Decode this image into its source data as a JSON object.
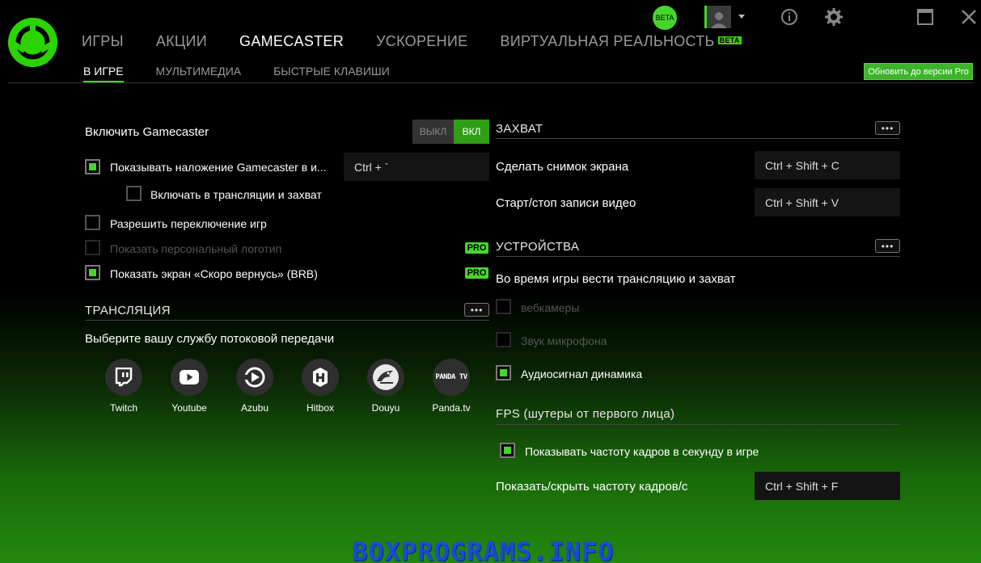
{
  "header": {
    "tabs": [
      {
        "label": "ИГРЫ"
      },
      {
        "label": "АКЦИИ"
      },
      {
        "label": "GAMECASTER",
        "active": true
      },
      {
        "label": "УСКОРЕНИЕ"
      },
      {
        "label": "ВИРТУАЛЬНАЯ РЕАЛЬНОСТЬ"
      }
    ],
    "vr_beta_tag": "BETA",
    "beta_badge": "BETA",
    "subtabs": [
      {
        "label": "В ИГРЕ",
        "active": true
      },
      {
        "label": "МУЛЬТИМЕДИА"
      },
      {
        "label": "БЫСТРЫЕ КЛАВИШИ"
      }
    ],
    "upgrade_label": "Обновить до версии Pro"
  },
  "left": {
    "enable_label": "Включить Gamecaster",
    "toggle_off": "ВЫКЛ",
    "toggle_on": "ВКЛ",
    "overlay_label": "Показывать наложение Gamecaster в и...",
    "overlay_key": "Ctrl + `",
    "include_stream_label": "Включать в трансляции и захват",
    "allow_switch_label": "Разрешить переключение игр",
    "personal_logo_label": "Показать персональный логотип",
    "brb_label": "Показать экран «Скоро вернусь» (BRB)",
    "pro_tag": "PRO",
    "broadcast_title": "ТРАНСЛЯЦИЯ",
    "more": "•••",
    "choose_service_label": "Выберите вашу службу потоковой передачи",
    "services": [
      {
        "name": "Twitch"
      },
      {
        "name": "Youtube"
      },
      {
        "name": "Azubu"
      },
      {
        "name": "Hitbox"
      },
      {
        "name": "Douyu"
      },
      {
        "name": "Panda.tv"
      }
    ],
    "panda_logo_text": "PANDA TV"
  },
  "right": {
    "capture_title": "ЗАХВАТ",
    "screenshot_label": "Сделать снимок экрана",
    "screenshot_key": "Ctrl + Shift + C",
    "record_label": "Старт/стоп записи видео",
    "record_key": "Ctrl + Shift + V",
    "devices_title": "УСТРОЙСТВА",
    "devices_desc": "Во время игры вести трансляцию и захват",
    "webcam_label": "вебкамеры",
    "mic_label": "Звук микрофона",
    "speaker_label": "Аудиосигнал динамика",
    "fps_title": "FPS (шутеры от первого лица)",
    "fps_show_label": "Показывать частоту кадров в секунду в игре",
    "fps_toggle_label": "Показать/скрыть частоту кадров/с",
    "fps_key": "Ctrl + Shift + F"
  },
  "watermark": "BOXPROGRAMS.INFO",
  "colors": {
    "accent": "#44d62c",
    "background": "#000000"
  }
}
